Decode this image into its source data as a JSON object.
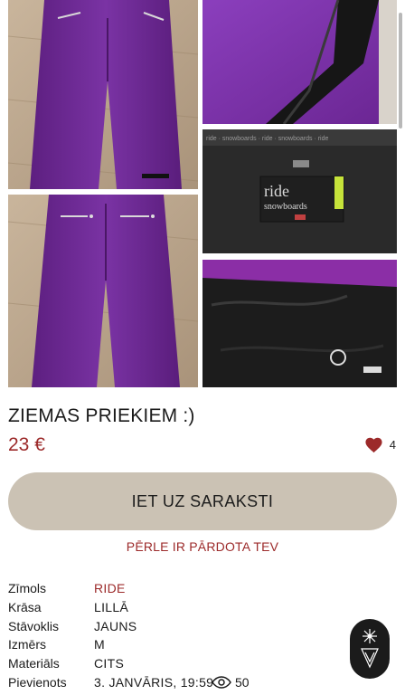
{
  "listing": {
    "title": "ZIEMAS PRIEKIEM :)",
    "price": "23 €",
    "likes": "4",
    "cta_label": "IET UZ SARAKSTI",
    "notice": "PĒRLE IR PĀRDOTA TEV"
  },
  "details": [
    {
      "key": "Zīmols",
      "value": "RIDE"
    },
    {
      "key": "Krāsa",
      "value": "LILLĀ"
    },
    {
      "key": "Stāvoklis",
      "value": "JAUNS"
    },
    {
      "key": "Izmērs",
      "value": "M"
    },
    {
      "key": "Materiāls",
      "value": "CITS"
    },
    {
      "key": "Pievienots",
      "value": "3. JANVĀRIS, 19:59",
      "views": "50"
    }
  ],
  "photos": {
    "label_text": "ride",
    "label_subtext": "snowboards"
  },
  "colors": {
    "accent": "#9c2a2a",
    "cta_bg": "#cbc2b4",
    "garment": "#6f2a94"
  },
  "icons": [
    "heart-icon",
    "eye-icon",
    "logo-icon"
  ]
}
